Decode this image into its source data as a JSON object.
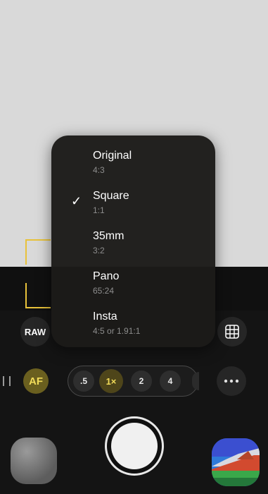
{
  "toolbar": {
    "raw_label": "RAW",
    "af_label": "AF"
  },
  "zoom": {
    "options": [
      ".5",
      "1×",
      "2",
      "4"
    ],
    "selected": "1×"
  },
  "format_menu": {
    "items": [
      {
        "label": "Original",
        "detail": "4:3",
        "selected": false
      },
      {
        "label": "Square",
        "detail": "1:1",
        "selected": true
      },
      {
        "label": "35mm",
        "detail": "3:2",
        "selected": false
      },
      {
        "label": "Pano",
        "detail": "65:24",
        "selected": false
      },
      {
        "label": "Insta",
        "detail": "4:5 or 1.91:1",
        "selected": false
      }
    ],
    "check_glyph": "✓"
  },
  "icons": {
    "grid": "grid-icon",
    "more": "ellipsis-icon",
    "shutter": "shutter-button",
    "thumbnail": "photo-thumbnail",
    "app": "app-icon"
  },
  "colors": {
    "accent_yellow": "#f2dc5a",
    "focus_bracket": "#e8c23a"
  }
}
